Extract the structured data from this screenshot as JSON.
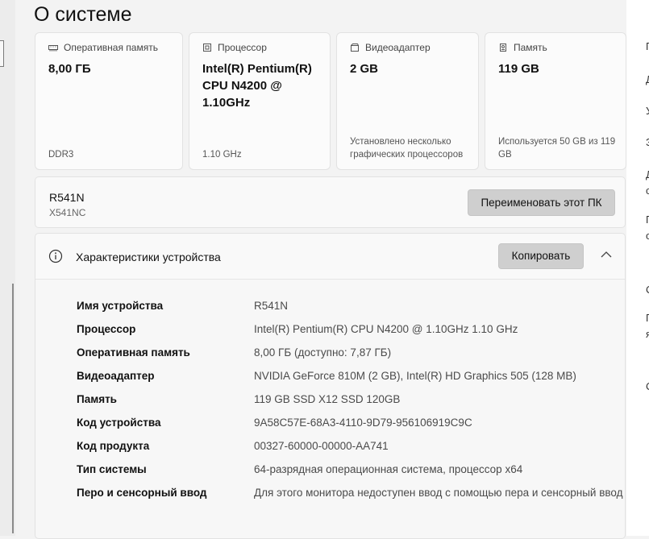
{
  "page": {
    "title": "О системе"
  },
  "cards": [
    {
      "label": "Оперативная память",
      "icon": "ram-icon",
      "value": "8,00 ГБ",
      "footer": "DDR3"
    },
    {
      "label": "Процессор",
      "icon": "processor-icon",
      "value": "Intel(R) Pentium(R) CPU N4200 @ 1.10GHz",
      "footer": "1.10 GHz"
    },
    {
      "label": "Видеоадаптер",
      "icon": "gpu-icon",
      "value": "2 GB",
      "footer": "Установлено несколько графических процессоров"
    },
    {
      "label": "Память",
      "icon": "storage-icon",
      "value": "119 GB",
      "footer": "Используется 50 GB из 119 GB"
    }
  ],
  "device": {
    "name": "R541N",
    "model": "X541NC",
    "rename_label": "Переименовать этот ПК"
  },
  "specs": {
    "title": "Характеристики устройства",
    "copy_label": "Копировать",
    "rows": [
      {
        "label": "Имя устройства",
        "value": "R541N"
      },
      {
        "label": "Процессор",
        "value": "Intel(R) Pentium(R) CPU N4200 @ 1.10GHz   1.10 GHz"
      },
      {
        "label": "Оперативная память",
        "value": "8,00 ГБ (доступно: 7,87 ГБ)"
      },
      {
        "label": "Видеоадаптер",
        "value": "NVIDIA GeForce 810M (2 GB), Intel(R) HD Graphics 505 (128 MB)"
      },
      {
        "label": "Память",
        "value": "119 GB SSD X12 SSD 120GB"
      },
      {
        "label": "Код устройства",
        "value": "9A58C57E-68A3-4110-9D79-956106919C9C"
      },
      {
        "label": "Код продукта",
        "value": "00327-60000-00000-AA741"
      },
      {
        "label": "Тип системы",
        "value": "64-разрядная операционная система, процессор x64"
      },
      {
        "label": "Перо и сенсорный ввод",
        "value": "Для этого монитора недоступен ввод с помощью пера и сенсорный ввод"
      }
    ]
  },
  "right_sidebar": {
    "fragments": [
      "П",
      "Д",
      "У",
      "З",
      "Д",
      "с",
      "П",
      "о",
      "С",
      "П",
      "я",
      "С"
    ]
  }
}
